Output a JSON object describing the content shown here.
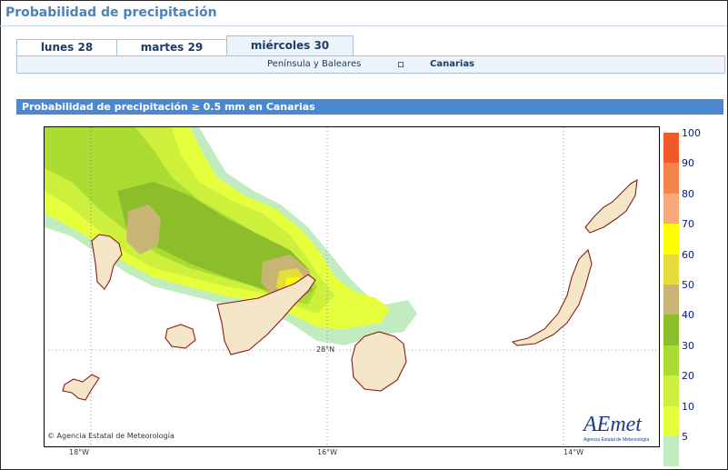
{
  "page": {
    "title": "Probabilidad de precipitación"
  },
  "tabs": [
    {
      "label": "lunes 28",
      "active": false
    },
    {
      "label": "martes 29",
      "active": false
    },
    {
      "label": "miércoles 30",
      "active": true
    }
  ],
  "regions": {
    "option_1": "Península y Baleares",
    "option_2": "Canarias",
    "selected": "Canarias"
  },
  "section": {
    "title": "Probabilidad de precipitación ≥ 0.5 mm en Canarias"
  },
  "map": {
    "lon_labels": [
      "18°W",
      "16°W",
      "14°W"
    ],
    "lat_label": "28°N",
    "credit": "Agencia Estatal de Meteorología",
    "credit_symbol": "©",
    "logo_text": "AEmet",
    "logo_subtitle": "Agencia Estatal de Meteorología"
  },
  "legend": {
    "labels": [
      "100",
      "90",
      "80",
      "70",
      "60",
      "50",
      "40",
      "30",
      "20",
      "10",
      "5"
    ],
    "colors": [
      "#f05a28",
      "#f5844a",
      "#f8aa7c",
      "#ffff00",
      "#e6dc3c",
      "#c8b474",
      "#8cbe2c",
      "#aadc32",
      "#ccf03c",
      "#e6ff3c",
      "#c0ecc0"
    ]
  }
}
